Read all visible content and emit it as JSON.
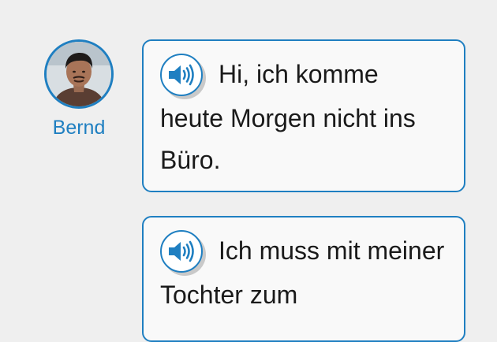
{
  "speaker": {
    "name": "Bernd"
  },
  "messages": [
    {
      "text": "Hi, ich komme heute Morgen nicht ins Büro."
    },
    {
      "text": "Ich muss mit meiner Tochter zum"
    }
  ],
  "colors": {
    "accent": "#1f7fc1",
    "background": "#efefef",
    "bubble": "#f9f9f9",
    "text": "#1a1a1a"
  },
  "icons": {
    "avatar": "speaker-photo",
    "audio": "speaker-volume-icon"
  }
}
